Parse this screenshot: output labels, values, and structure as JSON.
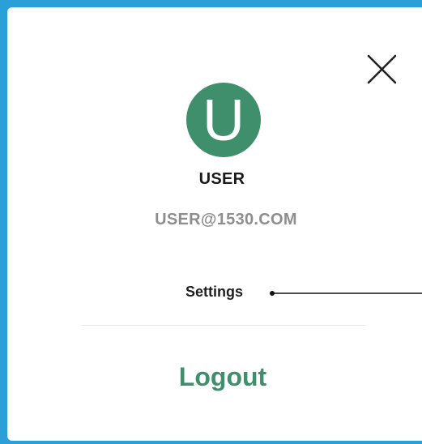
{
  "user_menu": {
    "avatar_initial": "U",
    "user_name": "USER",
    "user_email": "USER@1530.COM",
    "settings_label": "Settings",
    "logout_label": "Logout"
  },
  "colors": {
    "frame": "#2b9fd8",
    "accent": "#3f8f6d",
    "panel": "#ffffff"
  },
  "icons": {
    "close": "close-icon"
  }
}
